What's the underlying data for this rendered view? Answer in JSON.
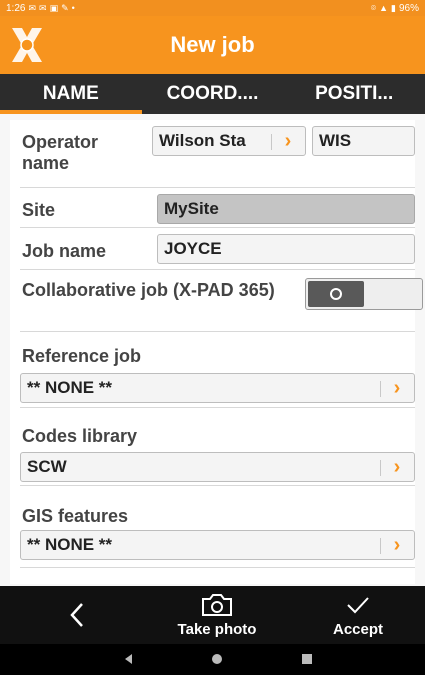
{
  "status_bar": {
    "time": "1:26",
    "battery": "96%"
  },
  "header": {
    "title": "New job"
  },
  "tabs": [
    {
      "label": "NAME",
      "active": true
    },
    {
      "label": "COORD....",
      "active": false
    },
    {
      "label": "POSITI...",
      "active": false
    }
  ],
  "form": {
    "operator": {
      "label": "Operator name",
      "name_value": "Wilson Sta",
      "code_value": "WIS"
    },
    "site": {
      "label": "Site",
      "value": "MySite"
    },
    "job_name": {
      "label": "Job name",
      "value": "JOYCE"
    },
    "collaborative": {
      "label": "Collaborative job (X-PAD 365)",
      "enabled": false
    },
    "reference_job": {
      "label": "Reference job",
      "value": "** NONE **"
    },
    "codes_library": {
      "label": "Codes library",
      "value": "SCW"
    },
    "gis_features": {
      "label": "GIS features",
      "value": "** NONE **"
    }
  },
  "bottom_bar": {
    "photo_label": "Take photo",
    "accept_label": "Accept"
  },
  "colors": {
    "accent": "#f7941e",
    "tab_bg": "#2c2c2c",
    "bottom_bg": "#111111"
  },
  "icons": {
    "back": "chevron-left-icon",
    "photo": "camera-icon",
    "accept": "check-icon"
  }
}
